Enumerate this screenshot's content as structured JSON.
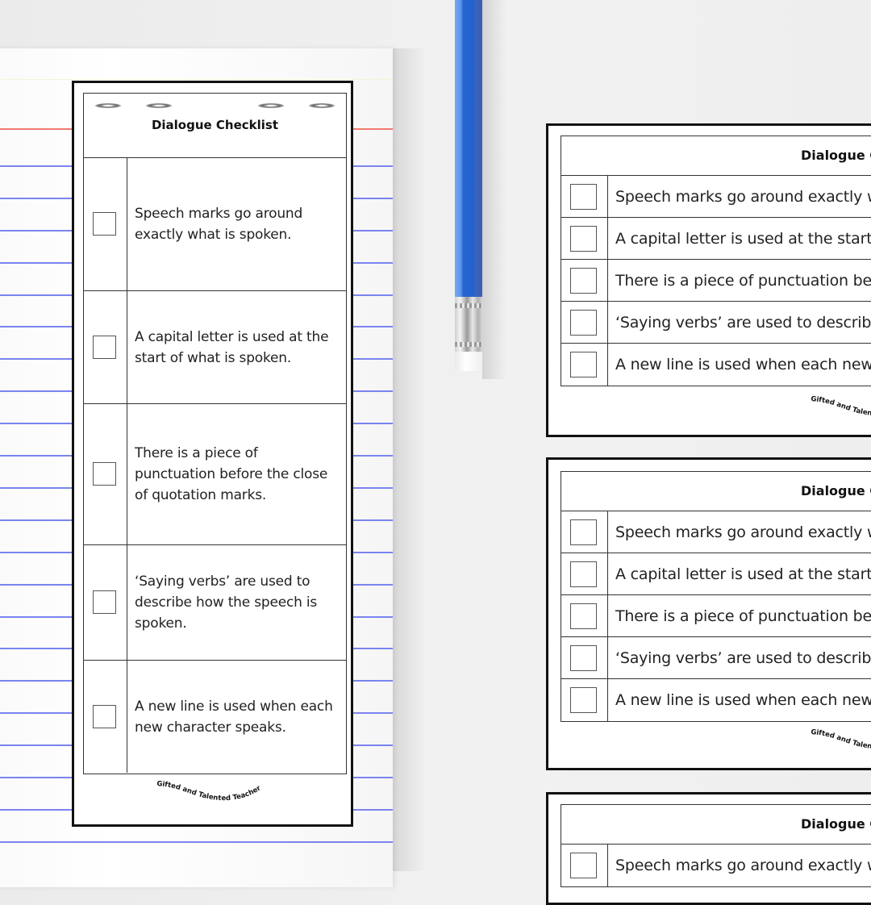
{
  "checklist": {
    "title": "Dialogue Checklist",
    "items": [
      "Speech marks go around exactly what is spoken.",
      "A capital letter is used at the start of what is spoken.",
      "There is a piece of punctuation before the close of quotation marks.",
      "‘Saying verbs’ are used to describe how the speech is spoken.",
      "A new line is used when each new character speaks."
    ],
    "brand": "Gifted and Talented Teacher"
  },
  "left_card": {
    "title": "Dialogue Checklist",
    "items": [
      "Speech marks go around exactly what is spoken.",
      "A capital letter is used at the start of what is spoken.",
      "There is a piece of punctuation before the close of quotation marks.",
      "‘Saying verbs’ are used to describe how the speech is spoken.",
      "A new line is used when each new character speaks."
    ],
    "brand": "Gifted and Talented Teacher"
  },
  "right_cards": [
    {
      "title": "Dialogue Checklist",
      "items": [
        "Speech marks go around exactly what is spoken.",
        "A capital letter is used at the start of what is spoken.",
        "There is a piece of punctuation before the close of quotation marks.",
        "‘Saying verbs’ are used to describe how the speech is spoken.",
        "A new line is used when each new character speaks."
      ],
      "brand": "Gifted and Talented Teacher"
    },
    {
      "title": "Dialogue Checklist",
      "items": [
        "Speech marks go around exactly what is spoken.",
        "A capital letter is used at the start of what is spoken.",
        "There is a piece of punctuation before the close of quotation marks.",
        "‘Saying verbs’ are used to describe how the speech is spoken.",
        "A new line is used when each new character speaks."
      ],
      "brand": "Gifted and Talented Teacher"
    },
    {
      "title": "Dialogue Checklist",
      "items": [
        "Speech marks go around exactly what is spoken."
      ]
    }
  ],
  "colors": {
    "pencil_blue": "#2566d0",
    "rule_blue": "#7a84ef",
    "margin_red": "#f07a72",
    "card_border": "#111111"
  }
}
